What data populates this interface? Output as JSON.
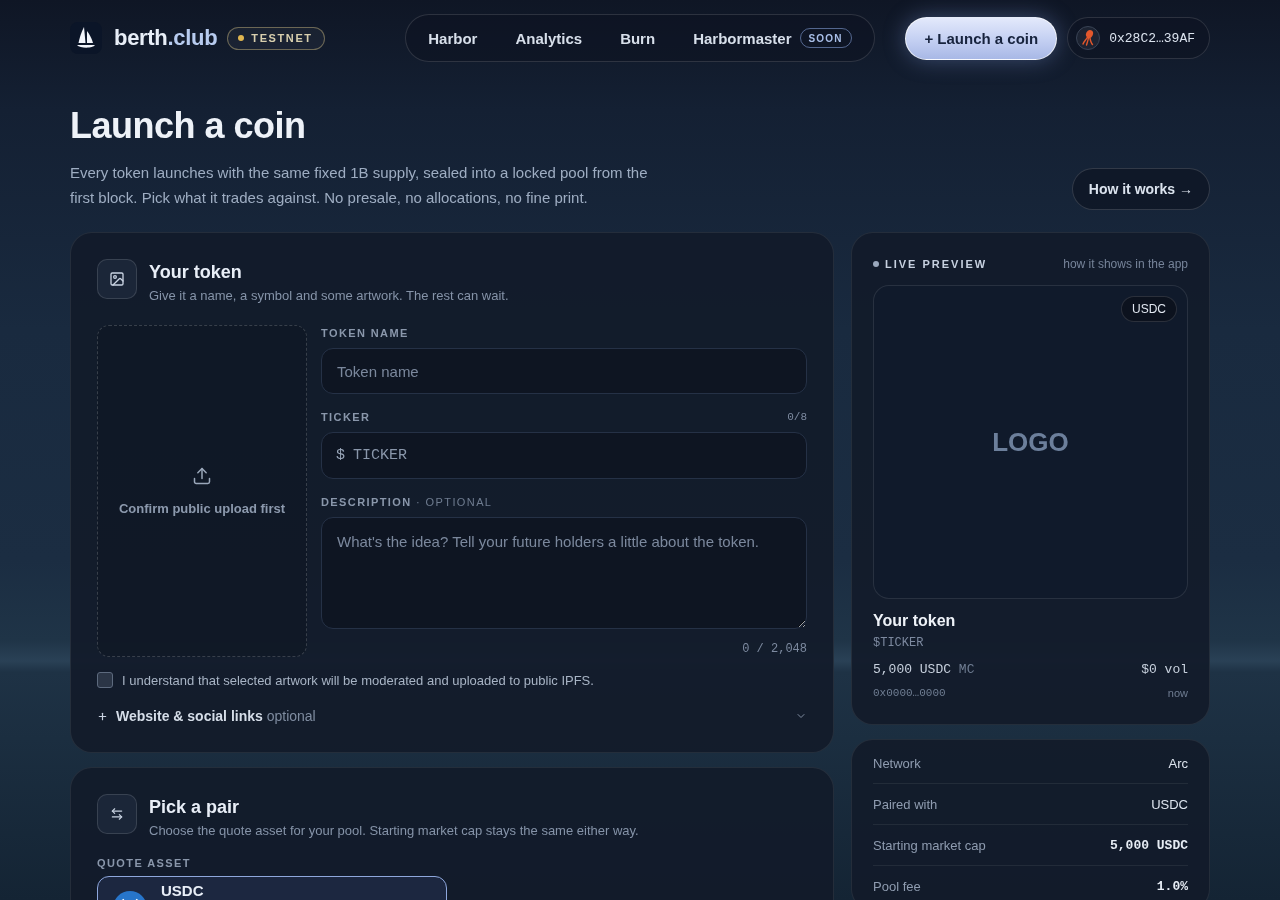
{
  "header": {
    "brand": {
      "name": "berth",
      "accent": ".club"
    },
    "network_badge": "TESTNET",
    "nav": [
      {
        "label": "Harbor",
        "selected": false
      },
      {
        "label": "Analytics",
        "selected": false
      },
      {
        "label": "Burn",
        "selected": false
      },
      {
        "label": "Harbormaster",
        "selected": false,
        "badge": "SOON"
      }
    ],
    "launch_button": "+ Launch a coin",
    "wallet": "0x28C2…39AF"
  },
  "hero": {
    "title": "Launch a coin",
    "description": "Every token launches with the same fixed 1B supply, sealed into a locked pool from the first block. Pick what it trades against. No presale, no allocations, no fine print.",
    "link": "How it works →"
  },
  "token_card": {
    "title": "Your token",
    "subtitle": "Give it a name, a symbol and some artwork. The rest can wait.",
    "upload": "Confirm public upload first",
    "fields": [
      {
        "kind": "text",
        "label": "TOKEN NAME",
        "placeholder": "Token name"
      },
      {
        "kind": "ticker",
        "label": "TICKER",
        "counter": "0/8",
        "prefix": "$",
        "placeholder": "TICKER"
      },
      {
        "kind": "textarea",
        "label": "DESCRIPTION",
        "hint": "· OPTIONAL",
        "placeholder": "What's the idea? Tell your future holders a little about the token.",
        "counter": "0 / 2,048"
      }
    ],
    "consent": {
      "checked": false,
      "text": "I understand that selected artwork will be moderated and uploaded to public IPFS."
    },
    "links": {
      "label": "**Website & social links** optional",
      "expanded": false
    }
  },
  "pair_card": {
    "title": "Pick a pair",
    "subtitle": "Choose the quote asset for your pool. Starting market cap stays the same either way.",
    "label": "QUOTE ASSET",
    "options": [
      {
        "symbol": "USDC",
        "selected": true
      }
    ]
  },
  "preview": {
    "title": "LIVE PREVIEW",
    "note": "how it shows in the app",
    "quote_badge": "USDC",
    "logo": "LOGO",
    "name": "Your token",
    "ticker": "$TICKER",
    "market_cap": "5,000 USDC",
    "market_cap_unit": "MC",
    "volume": "$0 vol",
    "address": "0x0000…0000",
    "age": "now"
  },
  "summary": [
    {
      "label": "Network",
      "value": "Arc",
      "kind": "text"
    },
    {
      "label": "Paired with",
      "value": "USDC",
      "kind": "text"
    },
    {
      "label": "Starting market cap",
      "value": "5,000 USDC",
      "kind": "mono"
    },
    {
      "label": "Pool fee",
      "value": "1.0%",
      "kind": "mono"
    }
  ]
}
